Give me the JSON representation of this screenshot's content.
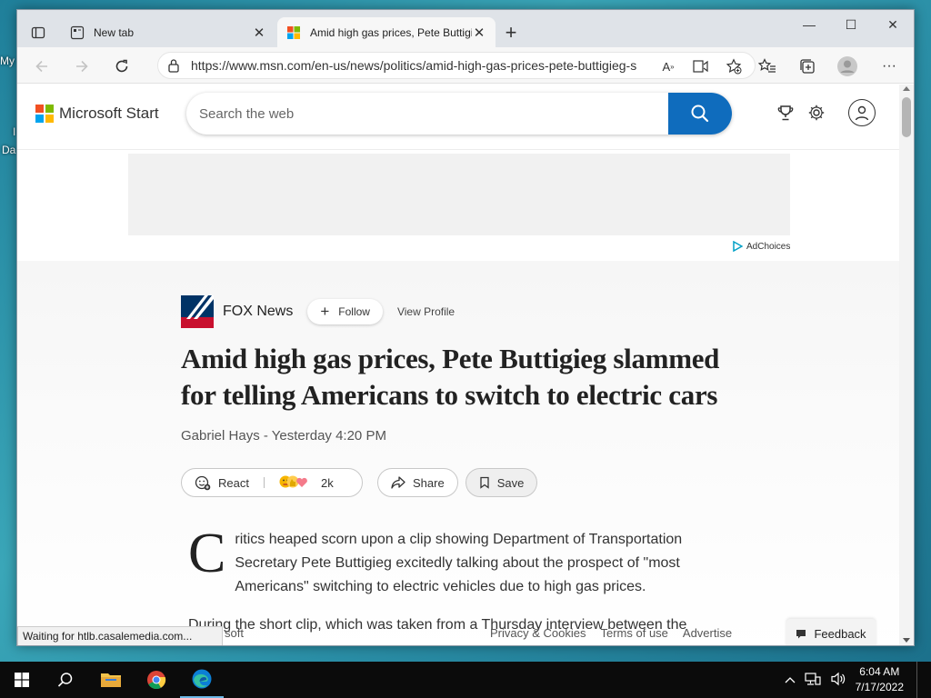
{
  "desktop": {
    "label_1": "My",
    "label_2": "I",
    "label_3": "Da"
  },
  "browser": {
    "tabs": [
      {
        "title": "New tab",
        "icon": "new-tab-icon"
      },
      {
        "title": "Amid high gas prices, Pete Buttigieg slammed for telling Americans to switch to electric cars",
        "icon": "microsoft-logo-icon"
      }
    ],
    "url": "https://www.msn.com/en-us/news/politics/amid-high-gas-prices-pete-buttigieg-slammed-for-telling-americans-to-switch-to-electric-cars"
  },
  "page": {
    "brand": "Microsoft Start",
    "search_placeholder": "Search the web",
    "adchoices": "AdChoices",
    "source": {
      "name": "FOX News",
      "follow_label": "Follow",
      "view_profile": "View Profile"
    },
    "headline": "Amid high gas prices, Pete Buttigieg slammed for telling Americans to switch to electric cars",
    "byline": "Gabriel Hays - Yesterday 4:20 PM",
    "actions": {
      "react": "React",
      "reaction_count": "2k",
      "share": "Share",
      "save": "Save"
    },
    "body": {
      "dropcap": "C",
      "para1": "ritics heaped scorn upon a clip showing Department of Transportation Secretary Pete Buttigieg excitedly talking about the prospect of \"most Americans\" switching to electric vehicles due to high gas prices.",
      "para2": "During the short clip, which was taken from a Thursday interview between the"
    },
    "footer": {
      "msft": "soft",
      "links": [
        "Privacy & Cookies",
        "Terms of use",
        "Advertise"
      ],
      "feedback": "Feedback"
    },
    "status": "Waiting for htlb.casalemedia.com..."
  },
  "taskbar": {
    "time": "6:04 AM",
    "date": "7/17/2022"
  },
  "colors": {
    "accent": "#0f6cbd",
    "fox_navy": "#003366",
    "fox_red": "#c8102e"
  }
}
